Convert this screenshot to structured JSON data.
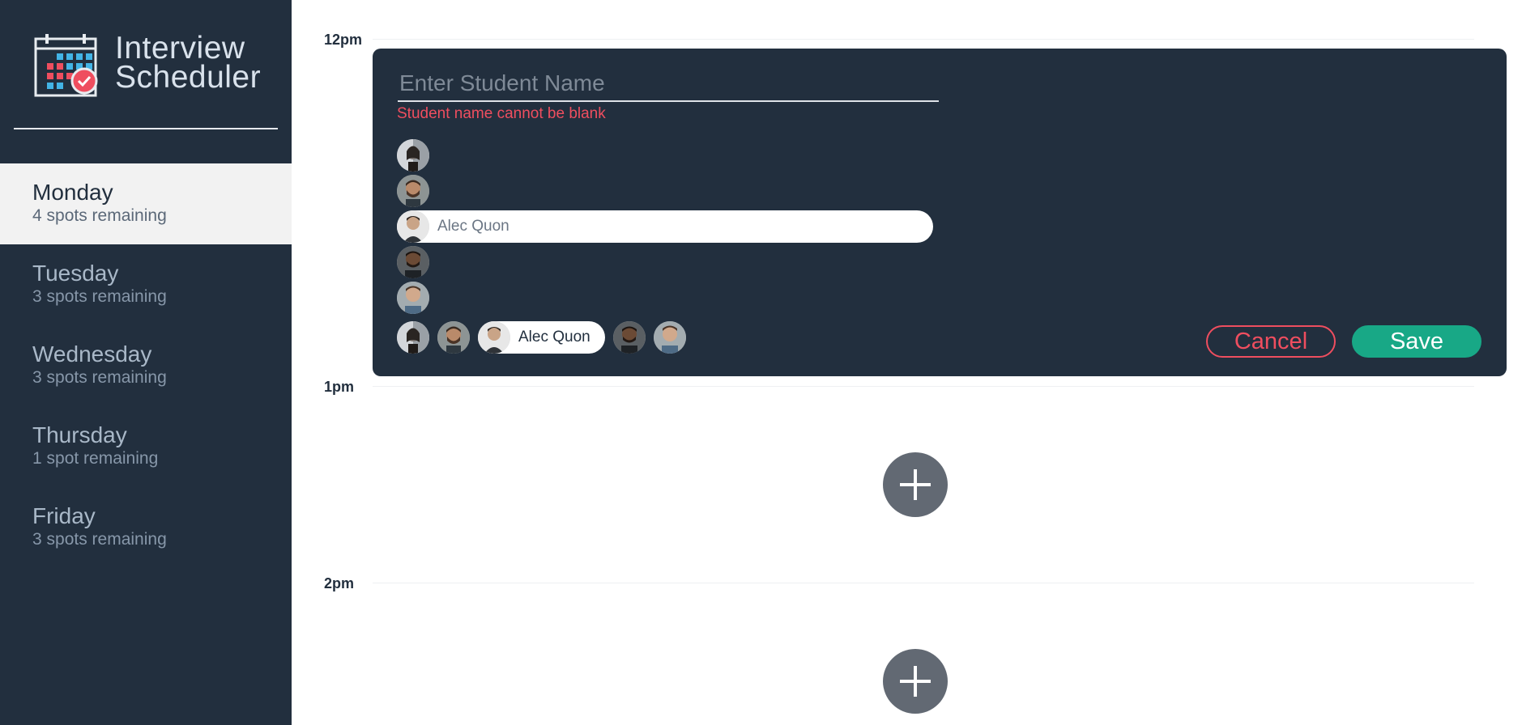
{
  "app": {
    "title_line1": "Interview",
    "title_line2": "Scheduler",
    "logo_icon": "calendar-check-icon"
  },
  "sidebar": {
    "days": [
      {
        "name": "Monday",
        "spots": "4 spots remaining",
        "selected": true
      },
      {
        "name": "Tuesday",
        "spots": "3 spots remaining",
        "selected": false
      },
      {
        "name": "Wednesday",
        "spots": "3 spots remaining",
        "selected": false
      },
      {
        "name": "Thursday",
        "spots": "1 spot remaining",
        "selected": false
      },
      {
        "name": "Friday",
        "spots": "3 spots remaining",
        "selected": false
      }
    ]
  },
  "schedule": {
    "slots": [
      {
        "time": "12pm"
      },
      {
        "time": "1pm"
      },
      {
        "time": "2pm"
      }
    ],
    "form": {
      "student_name_value": "",
      "student_name_placeholder": "Enter Student Name",
      "error": "Student name cannot be blank",
      "interviewers": [
        {
          "name": "",
          "avatar": "avatar-woman"
        },
        {
          "name": "",
          "avatar": "avatar-man-beard"
        },
        {
          "name": "Alec Quon",
          "avatar": "avatar-alec",
          "selected": true
        },
        {
          "name": "",
          "avatar": "avatar-man-dark"
        },
        {
          "name": "",
          "avatar": "avatar-man-light"
        }
      ],
      "cancel_label": "Cancel",
      "save_label": "Save"
    },
    "add_icon": "plus-icon"
  },
  "colors": {
    "sidebar_bg": "#222f3e",
    "selected_day_bg": "#f2f2f2",
    "error": "#ef4e5f",
    "save": "#18a886",
    "add_button": "#626973"
  }
}
